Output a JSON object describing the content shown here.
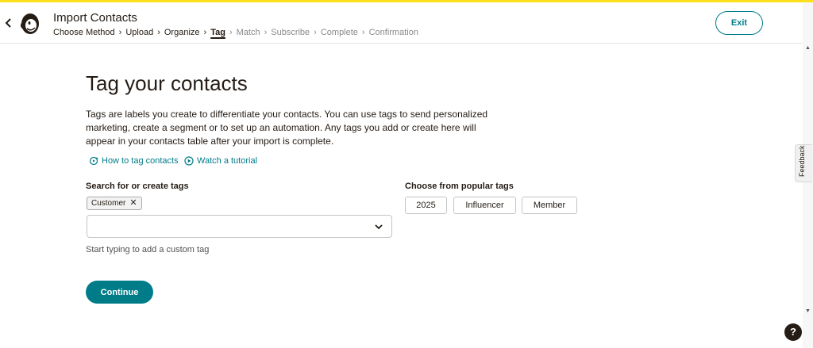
{
  "app": {
    "accent_color": "#ffe01b",
    "brand_color": "#007c89"
  },
  "header": {
    "back_icon": "chevron-left-icon",
    "logo_icon": "mailchimp-freddie-logo",
    "title": "Import Contacts",
    "breadcrumbs": [
      {
        "label": "Choose Method",
        "state": "done"
      },
      {
        "label": "Upload",
        "state": "done"
      },
      {
        "label": "Organize",
        "state": "done"
      },
      {
        "label": "Tag",
        "state": "active"
      },
      {
        "label": "Match",
        "state": "disabled"
      },
      {
        "label": "Subscribe",
        "state": "disabled"
      },
      {
        "label": "Complete",
        "state": "disabled"
      },
      {
        "label": "Confirmation",
        "state": "disabled"
      }
    ],
    "exit_label": "Exit"
  },
  "main": {
    "title": "Tag your contacts",
    "intro": "Tags are labels you create to differentiate your contacts. You can use tags to send personalized marketing, create a segment or to set up an automation. Any tags you add or create here will appear in your contacts table after your import is complete.",
    "links": [
      {
        "label": "How to tag contacts",
        "icon": "tag-sparkle-icon"
      },
      {
        "label": "Watch a tutorial",
        "icon": "play-circle-icon"
      }
    ],
    "search": {
      "label": "Search for or create tags",
      "selected_tags": [
        "Customer"
      ],
      "input_value": "",
      "input_placeholder": "",
      "hint": "Start typing to add a custom tag"
    },
    "popular": {
      "label": "Choose from popular tags",
      "tags": [
        "2025",
        "Influencer",
        "Member"
      ]
    },
    "continue_label": "Continue"
  },
  "side": {
    "feedback_label": "Feedback",
    "help_label": "?"
  }
}
